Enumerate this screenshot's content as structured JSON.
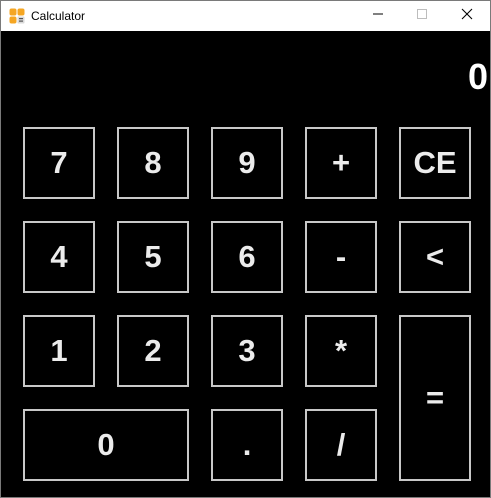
{
  "window": {
    "title": "Calculator",
    "app_icon": "calculator-app-icon",
    "controls": [
      "minimize-icon",
      "maximize-icon",
      "close-icon"
    ]
  },
  "display": {
    "value": "0"
  },
  "keypad": {
    "k7": "7",
    "k8": "8",
    "k9": "9",
    "plus": "+",
    "ce": "CE",
    "k4": "4",
    "k5": "5",
    "k6": "6",
    "minus": "-",
    "backspace": "<",
    "k1": "1",
    "k2": "2",
    "k3": "3",
    "multiply": "*",
    "equals": "=",
    "k0": "0",
    "decimal": ".",
    "divide": "/"
  },
  "colors": {
    "background": "#000000",
    "titlebar": "#ffffff",
    "key_border": "#c8c8c8",
    "key_text": "#ececec",
    "display_text": "#ffffff",
    "icon_orange": "#f5a623"
  }
}
